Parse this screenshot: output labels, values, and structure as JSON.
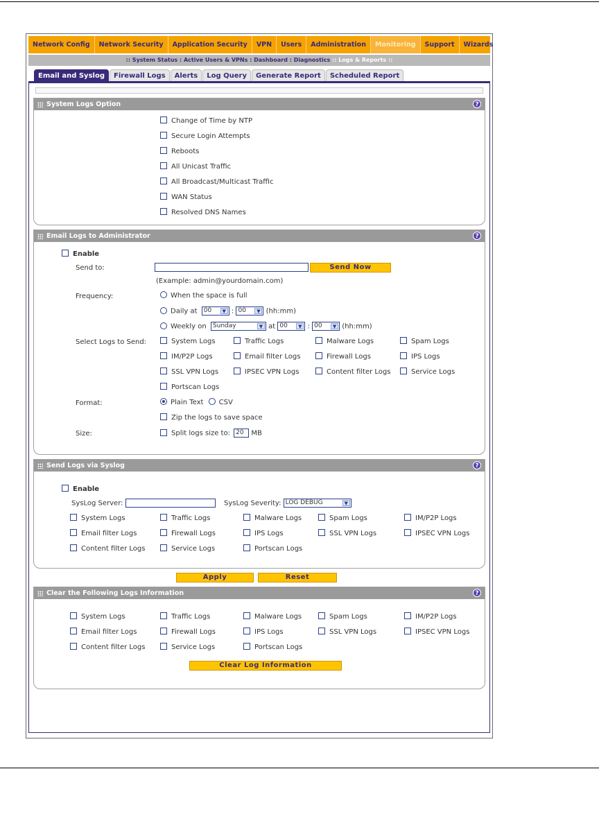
{
  "topnav": {
    "items": [
      "Network Config",
      "Network Security",
      "Application Security",
      "VPN",
      "Users",
      "Administration",
      "Monitoring",
      "Support",
      "Wizards"
    ]
  },
  "subnav": {
    "items": [
      ":: System Status",
      ": Active Users & VPNs",
      ": Dashboard",
      ": Diagnostics",
      ":: Logs & Reports ::"
    ]
  },
  "tabs": [
    "Email and Syslog",
    "Firewall Logs",
    "Alerts",
    "Log Query",
    "Generate Report",
    "Scheduled Report"
  ],
  "system_logs": {
    "title": "System Logs Option",
    "options": [
      "Change of Time by NTP",
      "Secure Login Attempts",
      "Reboots",
      "All Unicast Traffic",
      "All Broadcast/Multicast Traffic",
      "WAN Status",
      "Resolved DNS Names"
    ]
  },
  "email_logs": {
    "title": "Email Logs to Administrator",
    "enable": "Enable",
    "send_to_label": "Send to:",
    "send_to_value": "",
    "send_now": "Send Now",
    "example": "(Example: admin@yourdomain.com)",
    "frequency_label": "Frequency:",
    "freq_full": "When the space is full",
    "freq_daily": "Daily at",
    "freq_weekly": "Weekly on",
    "hour": "00",
    "minute": "00",
    "weekday": "Sunday",
    "at": "at",
    "colon": ":",
    "hhmm": "(hh:mm)",
    "select_logs_label": "Select Logs to Send:",
    "logs": [
      "System Logs",
      "Traffic Logs",
      "Malware Logs",
      "Spam Logs",
      "IM/P2P Logs",
      "Email filter Logs",
      "Firewall Logs",
      "IPS Logs",
      "SSL VPN Logs",
      "IPSEC VPN Logs",
      "Content filter Logs",
      "Service Logs",
      "Portscan Logs"
    ],
    "format_label": "Format:",
    "format_plain": "Plain Text",
    "format_csv": "CSV",
    "zip": "Zip the logs to save space",
    "size_label": "Size:",
    "split": "Split logs size to:",
    "split_value": "20",
    "mb": "MB"
  },
  "syslog": {
    "title": "Send Logs via Syslog",
    "enable": "Enable",
    "server_label": "SysLog Server:",
    "server_value": "",
    "severity_label": "SysLog Severity:",
    "severity_value": "LOG DEBUG",
    "logs": [
      "System Logs",
      "Traffic Logs",
      "Malware Logs",
      "Spam Logs",
      "IM/P2P Logs",
      "Email filter Logs",
      "Firewall Logs",
      "IPS Logs",
      "SSL VPN Logs",
      "IPSEC VPN Logs",
      "Content filter Logs",
      "Service Logs",
      "Portscan Logs"
    ]
  },
  "actions": {
    "apply": "Apply",
    "reset": "Reset"
  },
  "clear_logs": {
    "title": "Clear the Following Logs Information",
    "logs": [
      "System Logs",
      "Traffic Logs",
      "Malware Logs",
      "Spam Logs",
      "IM/P2P Logs",
      "Email filter Logs",
      "Firewall Logs",
      "IPS Logs",
      "SSL VPN Logs",
      "IPSEC VPN Logs",
      "Content filter Logs",
      "Service Logs",
      "Portscan Logs"
    ],
    "button": "Clear Log Information"
  },
  "help_icon": "?",
  "colors": {
    "nav": "#f5a300",
    "tab_active": "#3a2a7a",
    "button": "#ffc400",
    "section_head": "#9a9a9a"
  }
}
